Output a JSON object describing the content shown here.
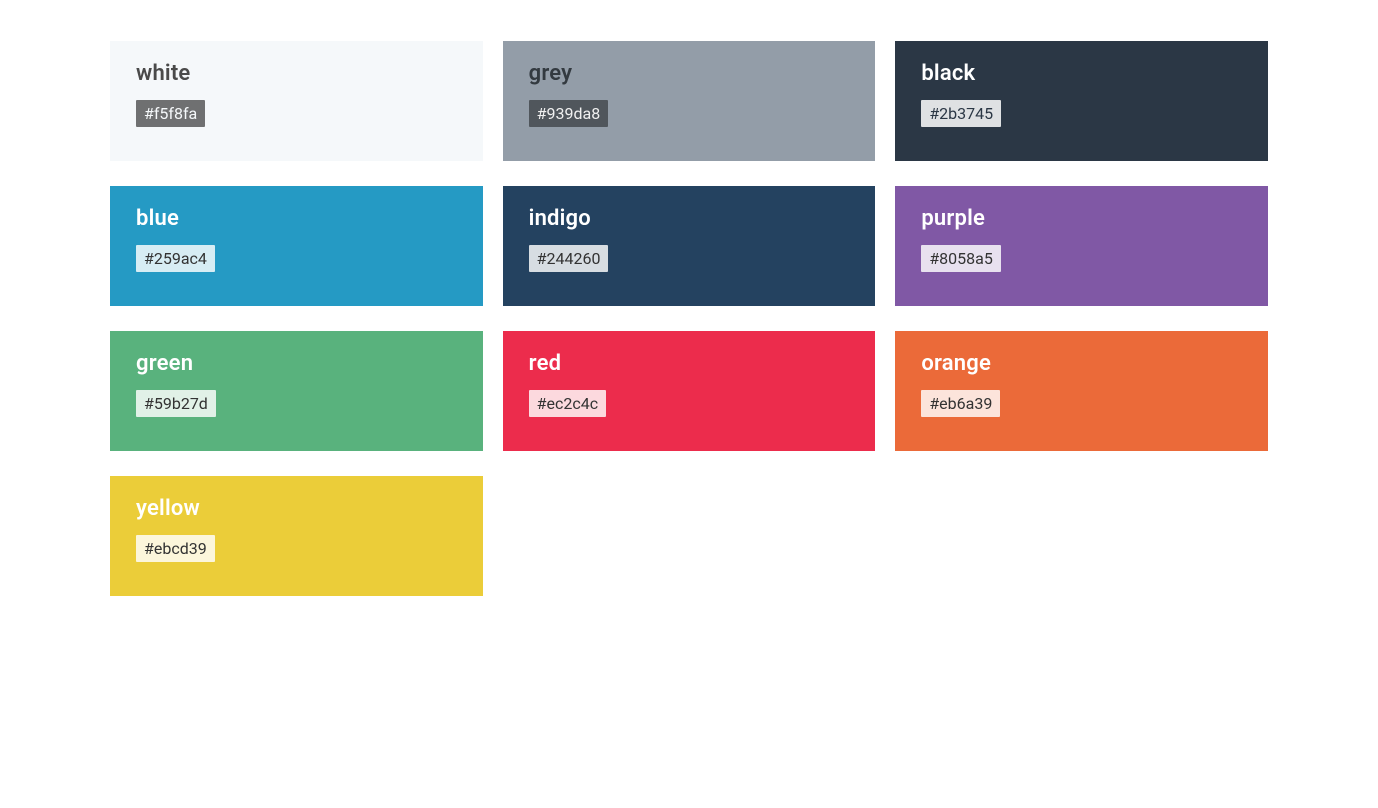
{
  "palette": [
    {
      "name": "white",
      "hex": "#f5f8fa",
      "bg": "#f5f8fa",
      "text_mode": "light"
    },
    {
      "name": "grey",
      "hex": "#939da8",
      "bg": "#939da8",
      "text_mode": "grey"
    },
    {
      "name": "black",
      "hex": "#2b3745",
      "bg": "#2b3745",
      "text_mode": "dark-black"
    },
    {
      "name": "blue",
      "hex": "#259ac4",
      "bg": "#259ac4",
      "text_mode": "dark"
    },
    {
      "name": "indigo",
      "hex": "#244260",
      "bg": "#244260",
      "text_mode": "dark"
    },
    {
      "name": "purple",
      "hex": "#8058a5",
      "bg": "#8058a5",
      "text_mode": "dark"
    },
    {
      "name": "green",
      "hex": "#59b27d",
      "bg": "#59b27d",
      "text_mode": "dark"
    },
    {
      "name": "red",
      "hex": "#ec2c4c",
      "bg": "#ec2c4c",
      "text_mode": "dark"
    },
    {
      "name": "orange",
      "hex": "#eb6a39",
      "bg": "#eb6a39",
      "text_mode": "dark"
    },
    {
      "name": "yellow",
      "hex": "#ebcd39",
      "bg": "#ebcd39",
      "text_mode": "dark"
    }
  ]
}
